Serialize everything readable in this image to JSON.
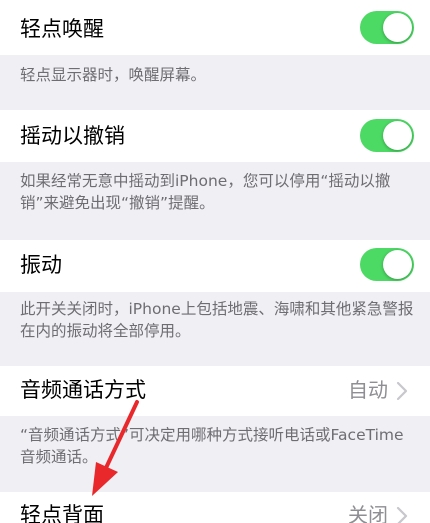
{
  "settings": {
    "tap_to_wake": {
      "label": "轻点唤醒",
      "toggle_on": true,
      "footer": "轻点显示器时，唤醒屏幕。"
    },
    "shake_to_undo": {
      "label": "摇动以撤销",
      "toggle_on": true,
      "footer": "如果经常无意中摇动到iPhone，您可以停用“摇动以撤销”来避免出现“撤销”提醒。"
    },
    "vibration": {
      "label": "振动",
      "toggle_on": true,
      "footer": "此开关关闭时，iPhone上包括地震、海啸和其他紧急警报在内的振动将全部停用。"
    },
    "call_audio_routing": {
      "label": "音频通话方式",
      "value": "自动",
      "footer": "“音频通话方式”可决定用哪种方式接听电话或FaceTime音频通话。"
    },
    "back_tap": {
      "label": "轻点背面",
      "value": "关闭"
    }
  },
  "colors": {
    "toggle_on": "#4cd964",
    "background": "#efeff4",
    "annotation_arrow": "#e8282b"
  }
}
